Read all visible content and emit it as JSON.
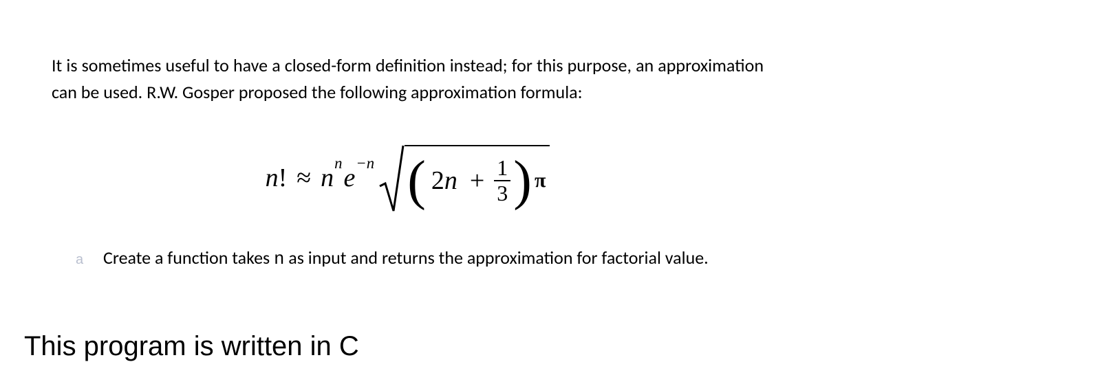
{
  "intro": "It is sometimes useful to have a closed-form definition instead; for this purpose, an approximation can be used. R.W. Gosper proposed the following approximation formula:",
  "formula": {
    "lhs_var": "n",
    "lhs_op": "!",
    "approx": "≈",
    "base1_var": "n",
    "base1_exp": "n",
    "base2_var": "e",
    "base2_exp": "−n",
    "inner_2n": "2n",
    "plus": "+",
    "frac_num": "1",
    "frac_den": "3",
    "pi": "π"
  },
  "task": {
    "marker": "a",
    "prefix": "Create a function takes ",
    "code": "n",
    "suffix": " as input and returns the approximation for factorial value."
  },
  "lang_note": "This program is written in C"
}
